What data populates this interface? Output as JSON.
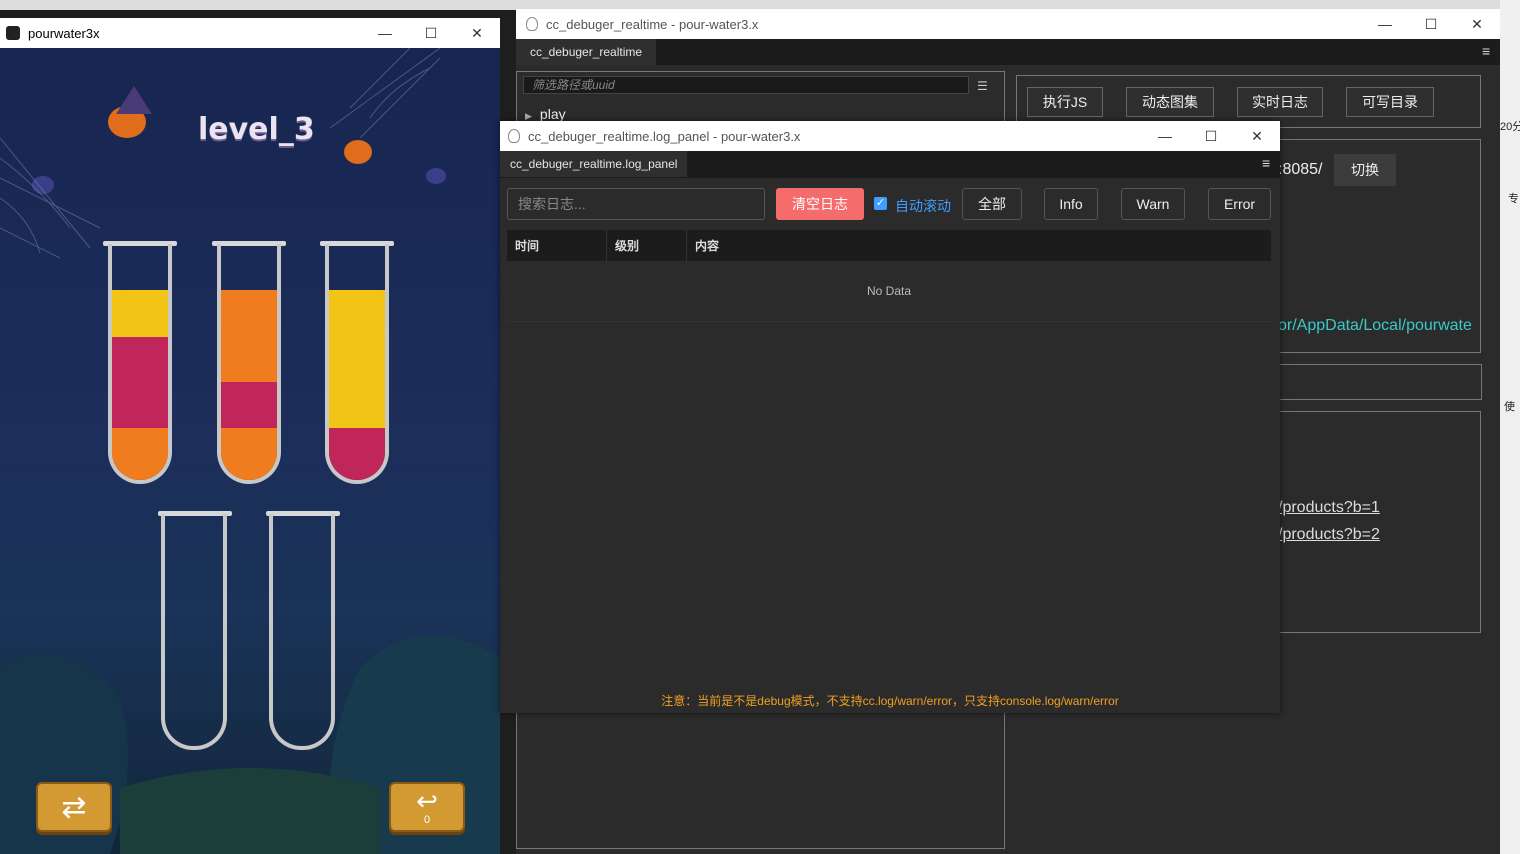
{
  "game": {
    "window_title": "pourwater3x",
    "level_title": "level_3",
    "undo_count": "0",
    "colors": {
      "yellow": "#f2c416",
      "magenta": "#c0265a",
      "orange": "#f07c20"
    }
  },
  "main": {
    "window_title": "cc_debuger_realtime - pour-water3.x",
    "tab": "cc_debuger_realtime",
    "filter_placeholder": "筛选路径或uuid",
    "tree_root": "play",
    "buttons": [
      "执行JS",
      "动态图集",
      "实时日志",
      "可写目录"
    ],
    "port_text": ":8085/",
    "switch_button": "切换",
    "path_text": "or/AppData/Local/pourwate",
    "links": [
      "/products?b=1",
      "/products?b=2"
    ]
  },
  "log": {
    "window_title": "cc_debuger_realtime.log_panel - pour-water3.x",
    "tab": "cc_debuger_realtime.log_panel",
    "search_placeholder": "搜索日志...",
    "clear_button": "清空日志",
    "auto_scroll_label": "自动滚动",
    "filter_buttons": [
      "全部",
      "Info",
      "Warn",
      "Error"
    ],
    "columns": [
      "时间",
      "级别",
      "内容"
    ],
    "empty_text": "No Data",
    "note": "注意：当前是不是debug模式，不支持cc.log/warn/error，只支持console.log/warn/error"
  },
  "desktop": {
    "right_edge_texts": [
      "20分",
      "专",
      "使"
    ]
  }
}
